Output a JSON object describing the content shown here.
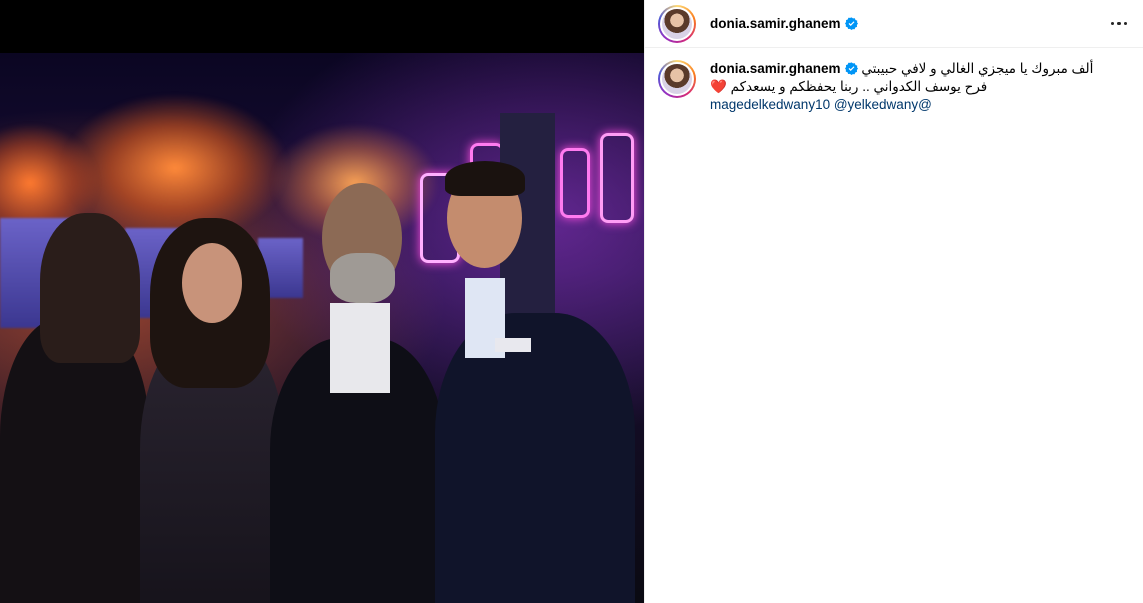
{
  "post": {
    "username": "donia.samir.ghanem",
    "caption_line1": "ألف مبروك يا ميجزي الغالي و لافي حبيبتي",
    "caption_line2": "فرح يوسف الكدواني .. ربنا يحفظكم و يسعدكم",
    "heart_emoji": "❤️",
    "mentions": "magedelkedwany10 @yelkedwany@"
  },
  "icons": {
    "verified": "verified-badge-icon",
    "more": "more-options-icon"
  },
  "colors": {
    "verified_blue": "#0095f6",
    "mention": "#00376b",
    "border": "#efefef"
  }
}
